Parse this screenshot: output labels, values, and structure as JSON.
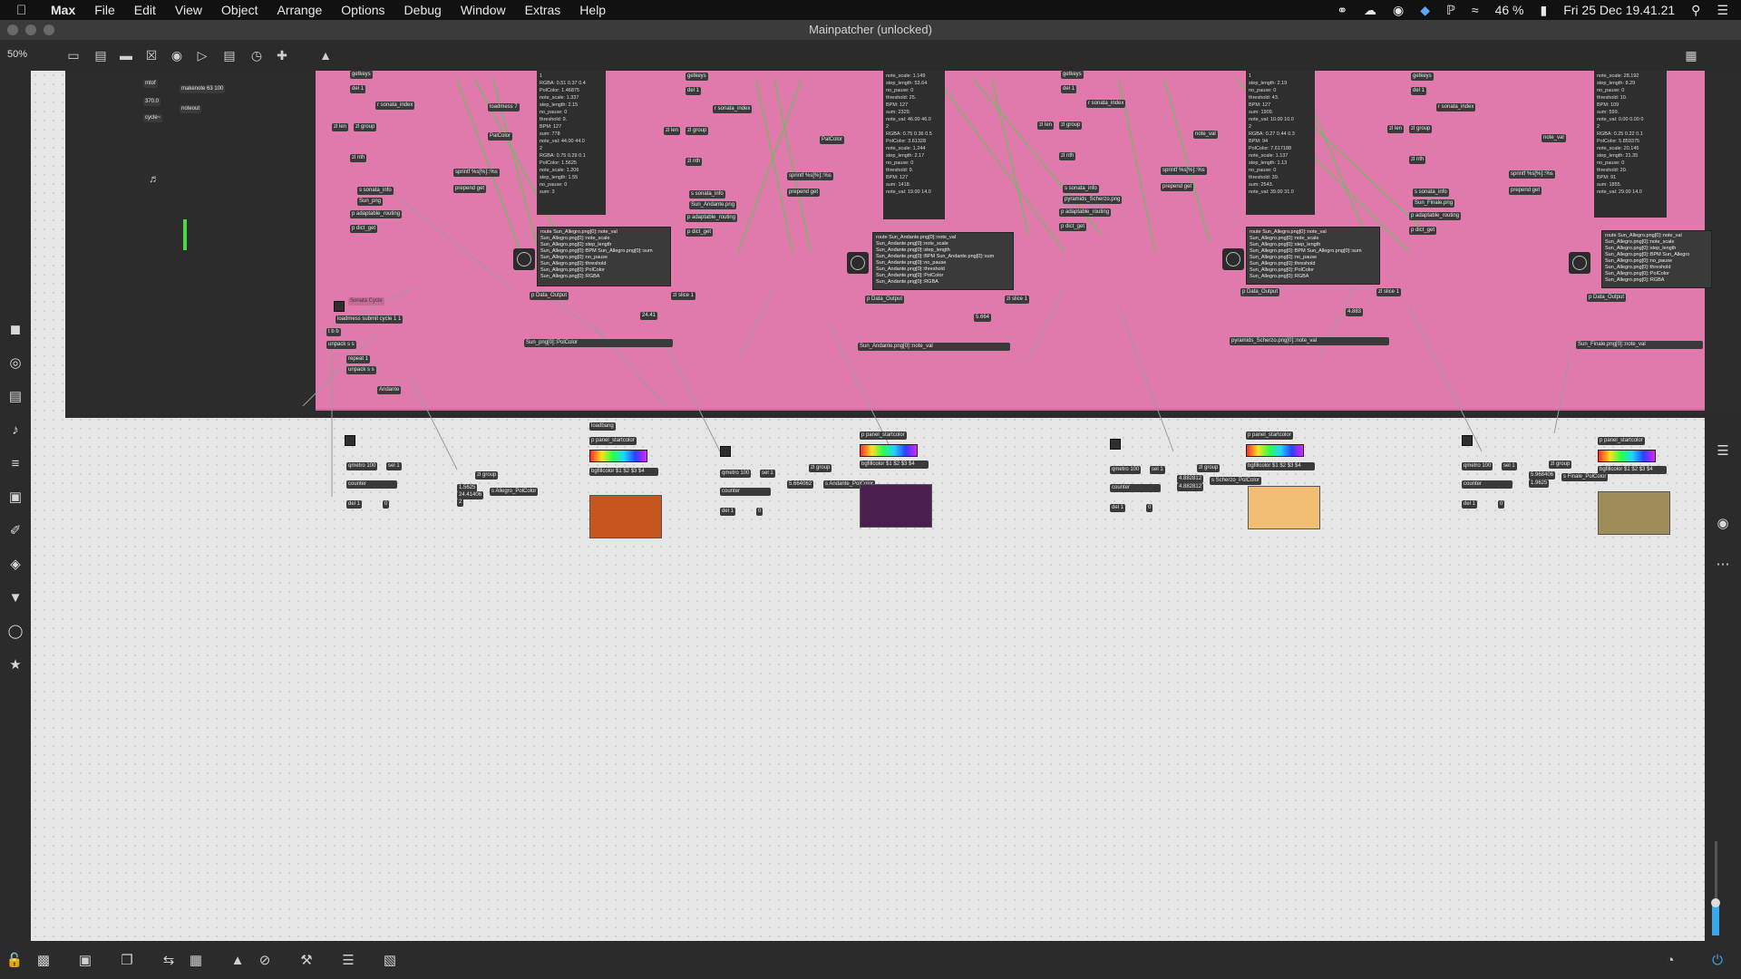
{
  "menubar": {
    "app": "Max",
    "items": [
      "File",
      "Edit",
      "View",
      "Object",
      "Arrange",
      "Options",
      "Debug",
      "Window",
      "Extras",
      "Help"
    ],
    "battery": "46 %",
    "clock": "Fri 25 Dec  19.41.21"
  },
  "window": {
    "title": "Mainpatcher (unlocked)"
  },
  "toolbar": {
    "zoom": "50%"
  },
  "left_patch": {
    "objects": [
      "mtof",
      "makenote 63 100",
      "370.0",
      "noteout",
      "cycle~"
    ]
  },
  "sections": [
    {
      "name": "Allegro",
      "objects": [
        "getkeys",
        "del 1",
        "r sonata_index",
        "zl len",
        "zl group",
        "zl nth",
        "loadmess 7",
        "PalColor",
        "sprintf %s[%]::%s",
        "prepend get",
        "s sonata_info",
        "Sun_png",
        "p adaptable_routing",
        "p dict_get"
      ],
      "list": "1\nRGBA: 0.51 0.37 0.4\nPolColor: 1.46875\nnote_scale: 1.337\nstep_length: 2.15\nno_pause: 0\nthreshold: 9.\nBPM: 127\nsum: 778\nnote_val: 44.00 44.0\n2\nRGBA: 0.75 0.29 0.1\nPolColor: 1.5625\nnote_scale: 1.206\nstep_length: 1.55\nno_pause: 0\nsum: 3",
      "route": "route Sun_Allegro.png[0]::note_val\nSun_Allegro.png[0]::note_scale\nSun_Allegro.png[0]::step_length\nSun_Allegro.png[0]::BPM Sun_Allegro.png[0]::sum\nSun_Allegro.png[0]::no_pause\nSun_Allegro.png[0]::threshold\nSun_Allegro.png[0]::PolColor\nSun_Allegro.png[0]::RGBA",
      "outputs": [
        "p Data_Output",
        "zl slice 1",
        "24.41",
        "Sun_png[0]::PolColor"
      ],
      "bottom": [
        "qmetro 100",
        "sel 1",
        "counter",
        "del 1",
        "0",
        "zl group",
        "1.5625",
        "24.41406",
        "2",
        "s Allegro_PolColor",
        "loadbang",
        "p panel_startcolor",
        "bgfillcolor $1 $2 $3 $4"
      ],
      "color": "#c4561e"
    },
    {
      "name": "Andante",
      "objects": [
        "getkeys",
        "del 1",
        "r sonata_index",
        "zl len",
        "zl group",
        "zl nth",
        "PalColor",
        "sprintf %s[%]::%s",
        "prepend get",
        "s sonata_info",
        "Sun_Andante.png",
        "p adaptable_routing",
        "p dict_get"
      ],
      "list": "note_scale: 1.149\nstep_length: 53.64\nno_pause: 0\nthreshold: 25.\nBPM: 127\nsum: 2329.\nnote_val: 46.00 46.0\n2\nRGBA: 0.75 0.36 0.5\nPolColor: 3.61328\nnote_scale: 1.244\nstep_length: 2.17\nno_pause: 0\nthreshold: 9.\nBPM: 127\nsum: 1418.\nnote_val: 19.00 14.0",
      "route": "route Sun_Andante.png[0]::note_val\nSun_Andante.png[0]::note_scale\nSun_Andante.png[0]::step_length\nSun_Andante.png[0]::BPM Sun_Andante.png[0]::sum\nSun_Andante.png[0]::no_pause\nSun_Andante.png[0]::threshold\nSun_Andante.png[0]::PolColor\nSun_Andante.png[0]::RGBA",
      "outputs": [
        "p Data_Output",
        "zl slice 1",
        "5.664",
        "Sun_Andante.png[0]::note_val"
      ],
      "bottom": [
        "qmetro 100",
        "sel 1",
        "counter",
        "del 1",
        "0",
        "zl group",
        "5.664062",
        "s Andante_PolColor",
        "p panel_startcolor",
        "bgfillcolor $1 $2 $3 $4"
      ],
      "color": "#4a1f4f"
    },
    {
      "name": "Scherzo",
      "objects": [
        "getkeys",
        "del 1",
        "r sonata_index",
        "zl len",
        "zl group",
        "zl nth",
        "note_val",
        "sprintf %s[%]::%s",
        "prepend get",
        "s sonata_info",
        "pyramids_Scherzo.png",
        "p adaptable_routing",
        "p dict_get"
      ],
      "list": "1\nstep_length: 2.19\nno_pause: 0\nthreshold: 43.\nBPM: 127\nsum: 1909.\nnote_val: 10.00 10.0\n2\nRGBA: 0.27 0.44 0.3\nBPM: 94\nPolColor: 7.617188\nnote_scale: 1.137\nstep_length: 1.13\nno_pause: 0\nthreshold: 39.\nsum: 2543.\nnote_val: 39.00 31.0",
      "route": "route Sun_Allegro.png[0]::note_val\nSun_Allegro.png[0]::note_scale\nSun_Allegro.png[0]::step_length\nSun_Allegro.png[0]::BPM Sun_Allegro.png[0]::sum\nSun_Allegro.png[0]::no_pause\nSun_Allegro.png[0]::threshold\nSun_Allegro.png[0]::PolColor\nSun_Allegro.png[0]::RGBA",
      "outputs": [
        "p Data_Output",
        "zl slice 1",
        "4.883",
        "pyramids_Scherzo.png[0]::note_val"
      ],
      "bottom": [
        "qmetro 100",
        "sel 1",
        "counter",
        "del 1",
        "0",
        "zl group",
        "4.882812",
        "4.882812",
        "s Scherzo_PolColor",
        "p panel_startcolor",
        "bgfillcolor $1 $2 $3 $4"
      ],
      "color": "#f2be74"
    },
    {
      "name": "Finale",
      "objects": [
        "getkeys",
        "del 1",
        "r sonata_index",
        "zl len",
        "zl group",
        "zl nth",
        "note_val",
        "sprintf %s[%]::%s",
        "prepend get",
        "s sonata_info",
        "Sun_Finale.png",
        "p adaptable_routing",
        "p dict_get"
      ],
      "list": "note_scale: 28.192\nstep_length: 8.29\nno_pause: 0\nthreshold: 10.\nBPM: 109\nsum: 599.\nnote_val: 0.00 0.00 0\n2\nRGBA: 0.25 0.22 0.1\nPolColor: 5.859375\nnote_scale: 20.145\nstep_length: 21.35\nno_pause: 0\nthreshold: 20.\nBPM: 91\nsum: 1855.\nnote_val: 29.00 14.0",
      "route": "route Sun_Allegro.png[0]::note_val\nSun_Allegro.png[0]::note_scale\nSun_Allegro.png[0]::step_length\nSun_Allegro.png[0]::BPM Sun_Allegro\nSun_Allegro.png[0]::no_pause\nSun_Allegro.png[0]::threshold\nSun_Allegro.png[0]::PolColor\nSun_Allegro.png[0]::RGBA",
      "outputs": [
        "p Data_Output",
        "Sun_Finale.png[0]::note_val"
      ],
      "bottom": [
        "qmetro 100",
        "sel 1",
        "counter",
        "del 1",
        "0",
        "zl group",
        "5.968406",
        "1.9625",
        "s Finale_PolColor",
        "p panel_startcolor",
        "bgfillcolor $1 $2 $3 $4"
      ],
      "color": "#a08c58"
    }
  ],
  "cycle_objects": [
    "Sonata Cycle",
    "loadmess submit cycle 1 1",
    "t b b",
    "unpack s s",
    "repeat 1",
    "unpack s s",
    "Andante"
  ],
  "icons": {
    "left": [
      "package-icon",
      "target-icon",
      "media-icon",
      "music-note-icon",
      "sequence-icon",
      "image-icon",
      "clip-icon",
      "puzzle-icon",
      "v-icon",
      "help-icon",
      "star-icon"
    ],
    "right": [
      "search-icon",
      "info-icon",
      "columns-icon",
      "list-icon",
      "camera-icon",
      "mixer-icon"
    ],
    "bottom": [
      "lock-icon",
      "presentation-icon",
      "comment-icon",
      "window-icon",
      "sync-icon",
      "grid-icon",
      "align-icon",
      "disabled-icon",
      "wrench-icon",
      "bars-icon",
      "keyboard-icon"
    ]
  },
  "volume_fraction": 0.35
}
